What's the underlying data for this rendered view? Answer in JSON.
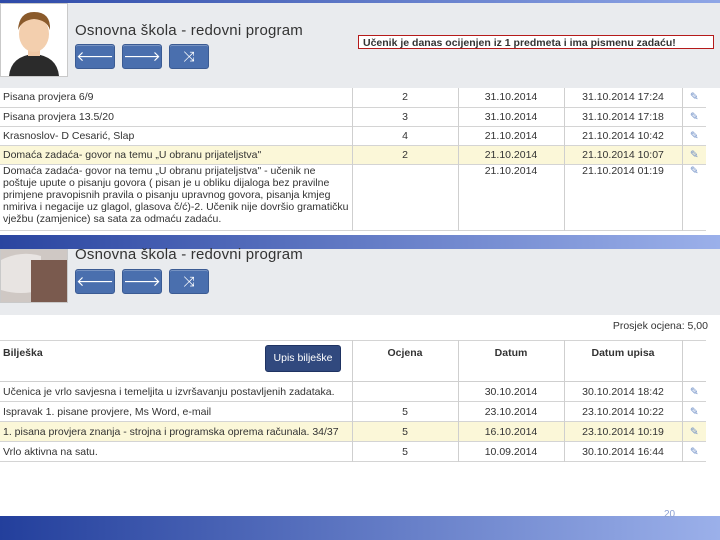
{
  "top_screen": {
    "school_title": "Osnovna škola - redovni program",
    "nav": {
      "back_icon": "🡐",
      "forward_icon": "🡒",
      "shuffle_icon": "⤨"
    },
    "notice": "Učenik je danas ocijenjen iz 1 predmeta i ima pismenu zadaću!",
    "rows": [
      {
        "note": "Pisana provjera 6/9",
        "grade": "2",
        "date": "31.10.2014",
        "entry_date": "31.10.2014 17:24"
      },
      {
        "note": "Pisana provjera 13.5/20",
        "grade": "3",
        "date": "31.10.2014",
        "entry_date": "31.10.2014 17:18"
      },
      {
        "note": "Krasnoslov- D Cesarić, Slap",
        "grade": "4",
        "date": "21.10.2014",
        "entry_date": "21.10.2014 10:42"
      },
      {
        "note": "Domaća zadaća- govor na temu „U obranu prijateljstva\"",
        "grade": "2",
        "date": "21.10.2014",
        "entry_date": "21.10.2014 10:07"
      },
      {
        "note": "Domaća zadaća- govor na temu „U obranu prijateljstva\" - učenik ne poštuje upute o pisanju govora ( pisan je u obliku dijaloga bez pravilne primjene pravopisnih pravila o pisanju upravnog govora, pisanja kmjeg nmiriva i negacije uz glagol, glasova č/ć)-2. Učenik nije dovršio gramatičku vježbu (zamjenice) sa sata za odmaću zadaću.",
        "grade": "",
        "date": "21.10.2014",
        "entry_date": "21.10.2014 01:19"
      }
    ]
  },
  "bottom_screen": {
    "school_title": "Osnovna škola - redovni program",
    "average": "Prosjek ocjena: 5,00",
    "headers": {
      "note": "Bilješka",
      "grade": "Ocjena",
      "date": "Datum",
      "entry_date": "Datum upisa"
    },
    "add_note_button": "Upis bilješke",
    "rows": [
      {
        "note": "Učenica je vrlo savjesna i temeljita u izvršavanju postavljenih zadataka.",
        "grade": "",
        "date": "30.10.2014",
        "entry_date": "30.10.2014 18:42"
      },
      {
        "note": "Ispravak 1. pisane provjere, Ms Word, e-mail",
        "grade": "5",
        "date": "23.10.2014",
        "entry_date": "23.10.2014 10:22"
      },
      {
        "note": "1. pisana provjera znanja - strojna i programska oprema računala. 34/37",
        "grade": "5",
        "date": "16.10.2014",
        "entry_date": "23.10.2014 10:19"
      },
      {
        "note": "Vrlo aktivna na satu.",
        "grade": "5",
        "date": "10.09.2014",
        "entry_date": "30.10.2014 16:44"
      }
    ]
  },
  "edit_icon": "✎",
  "page_number": "20",
  "colors": {
    "accent_blue": "#4a6fae",
    "notice_border": "#b51a1a",
    "highlight_row": "#fbf7d8"
  }
}
